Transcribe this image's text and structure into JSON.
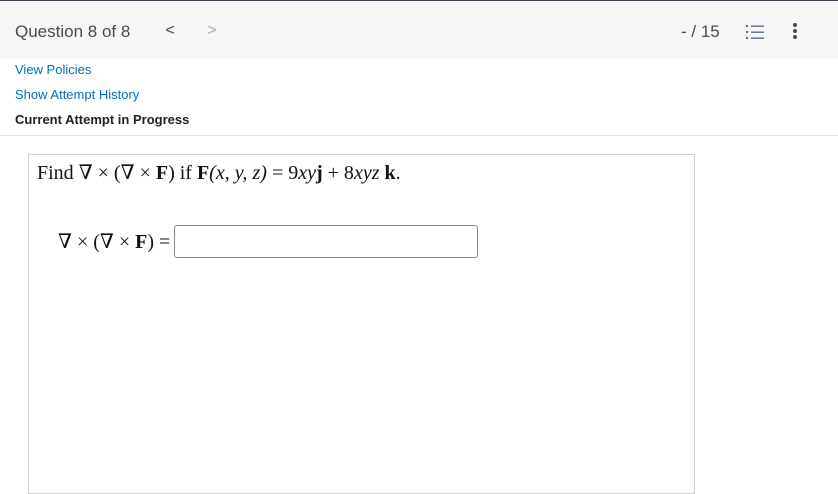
{
  "header": {
    "question_title": "Question 8 of 8",
    "prev_glyph": "<",
    "next_glyph": ">",
    "score": "- / 15",
    "list_icon": "list-numbered-icon",
    "more_icon": "more-vertical-icon"
  },
  "links": {
    "view_policies": "View Policies",
    "show_attempt_history": "Show Attempt History"
  },
  "attempt_status": "Current Attempt in Progress",
  "question": {
    "prompt": {
      "find": "Find ",
      "curl_curl": "∇ × (∇ × ",
      "F": "F",
      "close_if": ") if ",
      "F2": "F",
      "args": "(x, y, z)",
      "eq": " = 9",
      "xy": "xy",
      "j": "j",
      "plus": " + 8",
      "xyz": "xyz",
      "k": "k",
      "period": "."
    },
    "answer": {
      "lhs_curl": "∇ × (∇ × ",
      "lhs_F": "F",
      "lhs_close": ") =",
      "value": ""
    }
  }
}
